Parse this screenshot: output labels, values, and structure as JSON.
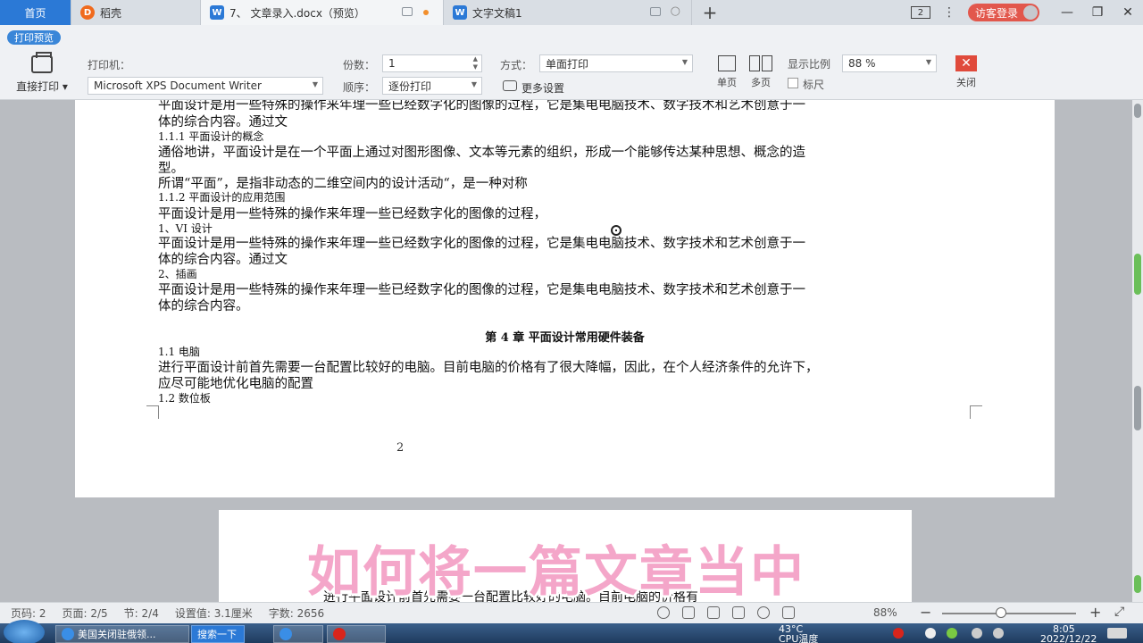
{
  "tabs": [
    {
      "label": "首页"
    },
    {
      "label": "稻壳"
    },
    {
      "label": "7、 文章录入.docx（预览）"
    },
    {
      "label": "文字文稿1"
    }
  ],
  "titlebar": {
    "window_count": "2",
    "login_label": "访客登录"
  },
  "ribbon": {
    "print_preview_label": "打印预览",
    "direct_print_label": "直接打印 ▾",
    "printer_label": "打印机：",
    "printer_value": "Microsoft XPS Document Writer",
    "copies_label": "份数：",
    "copies_value": "1",
    "order_label": "顺序：",
    "order_value": "逐份打印",
    "mode_label": "方式：",
    "mode_value": "单面打印",
    "more_settings_label": "更多设置",
    "single_page_label": "单页",
    "multi_page_label": "多页",
    "zoom_label": "显示比例",
    "zoom_value": "88 %",
    "ruler_label": "标尺",
    "close_label": "关闭"
  },
  "document": {
    "lines": [
      "平面设计是用一些特殊的操作来年理一些已经数字化的图像的过程，它是集电电脑技术、数字技术和艺术创意于一",
      "体的综合内容。通过文",
      "1.1.1 平面设计的概念",
      "通俗地讲，平面设计是在一个平面上通过对图形图像、文本等元素的组织，形成一个能够传达某种思想、概念的造",
      "型。",
      "所谓“平面”，是指非动态的二维空间内的设计活动“，是一种对称",
      "1.1.2 平面设计的应用范围",
      "平面设计是用一些特殊的操作来年理一些已经数字化的图像的过程，",
      "1、VI 设计",
      "平面设计是用一些特殊的操作来年理一些已经数字化的图像的过程，它是集电电脑技术、数字技术和艺术创意于一",
      "体的综合内容。通过文",
      "2、插画",
      "平面设计是用一些特殊的操作来年理一些已经数字化的图像的过程，它是集电电脑技术、数字技术和艺术创意于一",
      "体的综合内容。"
    ],
    "chapter_title": "第 4 章  平面设计常用硬件装备",
    "lines2": [
      "1.1 电脑",
      "进行平面设计前首先需要一台配置比较好的电脑。目前电脑的价格有了很大降幅，因此，在个人经济条件的允许下，",
      "应尽可能地优化电脑的配置",
      "1.2 数位板"
    ],
    "page_number": "2",
    "page2_line": "进行平面设计前首先需要一台配置比较好的电脑。目前电脑的价格有",
    "subtitle_overlay": "如何将一篇文章当中"
  },
  "statusbar": {
    "page_code": "页码: 2",
    "pages": "页面: 2/5",
    "section": "节: 2/4",
    "setting": "设置值: 3.1厘米",
    "word_count": "字数: 2656",
    "zoom": "88%"
  },
  "taskbar": {
    "items": [
      {
        "label": "美国关闭驻俄领..."
      },
      {
        "label": "搜索一下"
      }
    ],
    "temperature": "43°C",
    "temp_sub": "CPU温度",
    "time": "8:05",
    "date": "2022/12/22"
  },
  "colors": {
    "accent": "#2b79d6",
    "login": "#e2574c",
    "close": "#e04a3b",
    "subtitle": "#f4a6c9"
  }
}
